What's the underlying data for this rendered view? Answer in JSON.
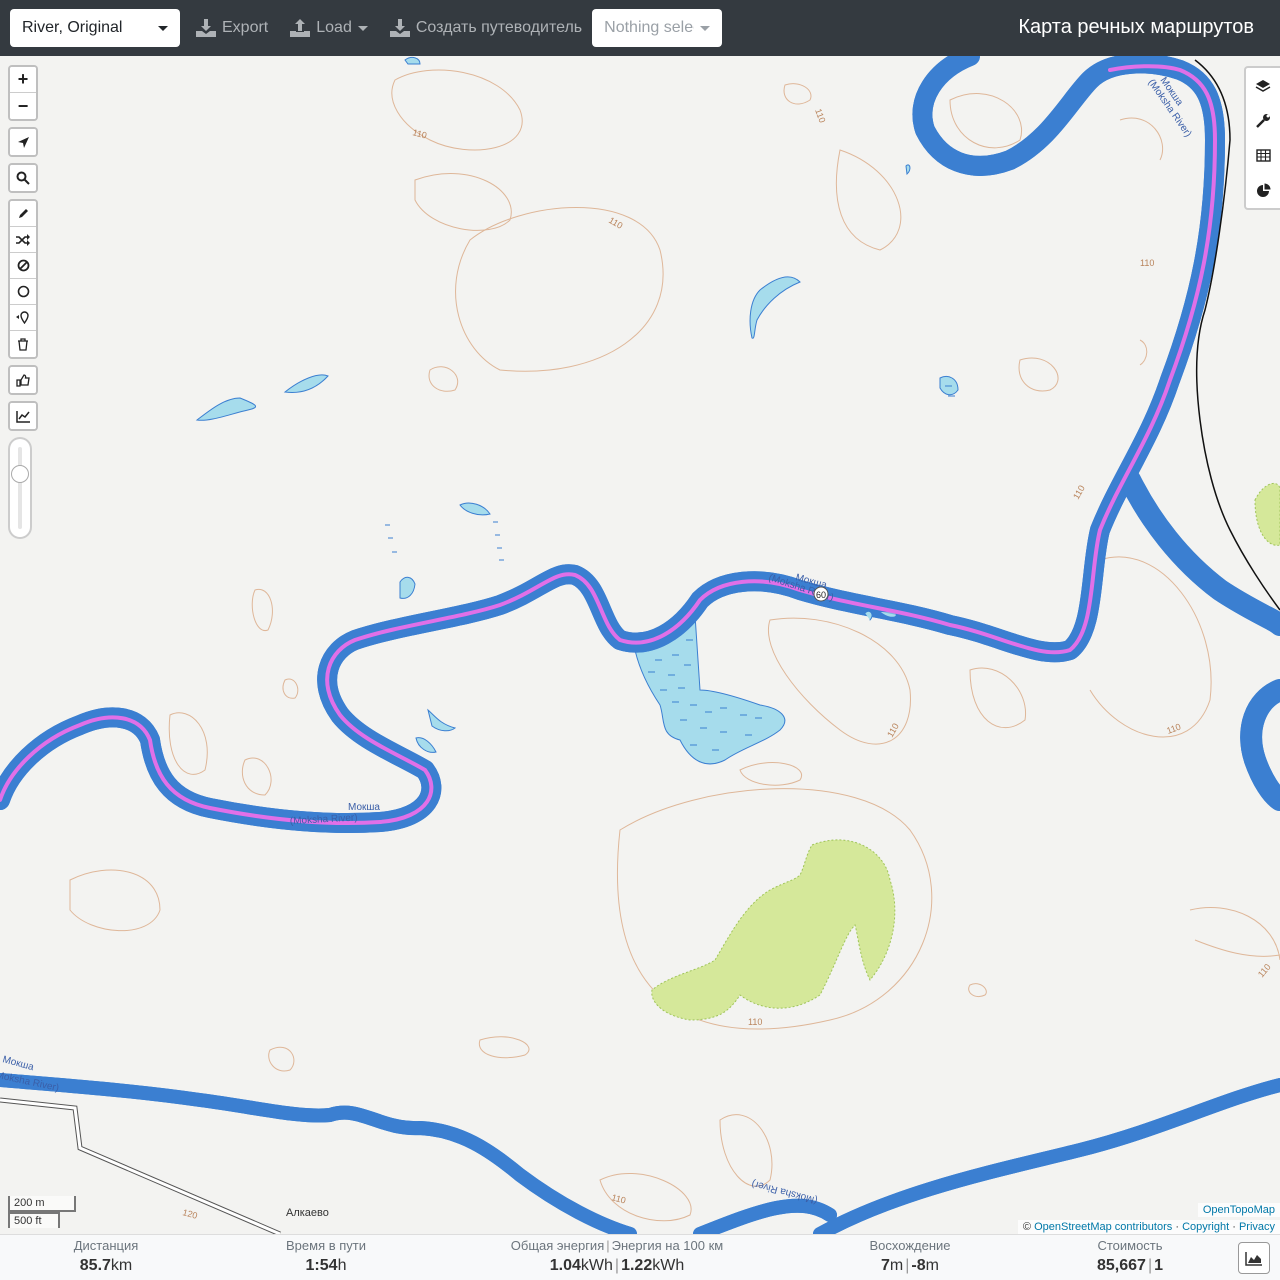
{
  "navbar": {
    "profile_selected": "River, Original",
    "export_label": "Export",
    "load_label": "Load",
    "guide_label": "Создать путеводитель",
    "nothing_selected": "Nothing selected",
    "brand": "Карта речных маршрутов"
  },
  "map": {
    "river_name": "Мокша",
    "river_name_latin": "(Moksha River)",
    "river_name_latin_cut": "(Moksha River)",
    "contour_label": "110",
    "contour_label_120": "120",
    "route_marker": "60",
    "village": "Алкаево",
    "scale_metric": "200 m",
    "scale_imperial": "500 ft",
    "attrib_tiles": "OpenTopoMap",
    "attrib_copy": "©",
    "attrib_osm": "OpenStreetMap contributors",
    "attrib_sep": "·",
    "attrib_copyright": "Copyright",
    "attrib_privacy": "Privacy",
    "colors": {
      "water": "#a6dcec",
      "water_edge": "#3b7fd1",
      "route": "#e070e8",
      "forest": "#d5e89a",
      "contour": "#d9a883"
    }
  },
  "toolbar": {
    "zoom_in": "+",
    "zoom_out": "−"
  },
  "stats": {
    "distance_label": "Дистанция",
    "distance_value": "85.7",
    "distance_unit": "km",
    "time_label": "Время в пути",
    "time_value": "1:54",
    "time_unit": "h",
    "energy_label": "Общая энергия",
    "energy_per100_label": "Энергия на 100 км",
    "energy_value": "1.04",
    "energy_unit": "kWh",
    "energy_per100_value": "1.22",
    "energy_per100_unit": "kWh",
    "ascent_label": "Восхождение",
    "ascent_up": "7",
    "ascent_down": "-8",
    "ascent_unit": "m",
    "cost_label": "Стоимость",
    "cost_value": "85,667",
    "cost_count": "1"
  }
}
